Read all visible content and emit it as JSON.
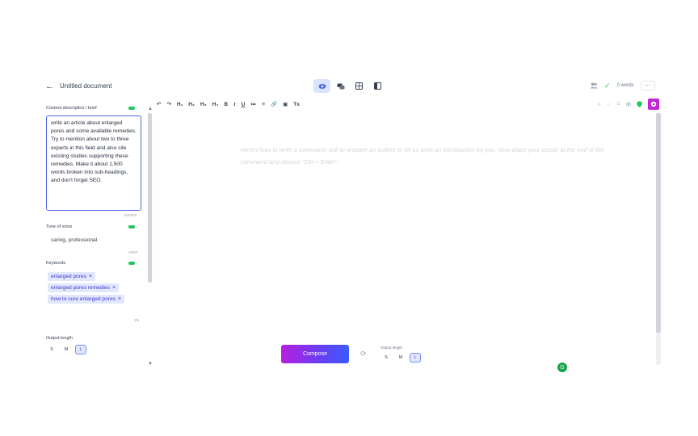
{
  "header": {
    "back_icon": "arrow-left-icon",
    "doc_title": "Untitled document",
    "view_modes": [
      "eye-icon",
      "chat-icon",
      "calculator-icon",
      "split-panel-icon"
    ],
    "words": "0 words",
    "more": "···"
  },
  "panel": {
    "brief_label": "Content description / brief",
    "brief_text": "write an article about enlarged pores and some available remedies. Try to mention about two to three experts in this field and also cite existing studies supporting these remedies. Make it about 1,500 words broken into sub-headings, and don't forget SEO.",
    "brief_count": "264/600",
    "tone_label": "Tone of voice",
    "tone_value": "caring, professional",
    "tone_count": "20/40",
    "keywords_label": "Keywords",
    "keywords": [
      "enlarged pores",
      "enlarged pores remedies",
      "how to cure enlarged pores"
    ],
    "keywords_count": "3/5",
    "output_label": "Output length",
    "sizes": [
      "S",
      "M",
      "L"
    ]
  },
  "toolbar": {
    "items": [
      "↶",
      "↷",
      "H₁",
      "H₂",
      "H₃",
      "H₄",
      "B",
      "I",
      "U",
      "≔",
      "≡",
      "🔗",
      "▣",
      "Tx"
    ]
  },
  "editor": {
    "placeholder": "Here's how to write a command: ask to prepare an outline or let us write an introduction for you. Now place your cursor at the end of the command and choose \"Ctrl + Enter\".",
    "compose_label": "Compose",
    "output_label": "Output length",
    "sizes": [
      "S",
      "M",
      "L"
    ]
  },
  "colors": {
    "accent": "#4f63e6",
    "compose_gradient_start": "#b620e0",
    "compose_gradient_end": "#3b5bfd",
    "toggle": "#22c55e"
  }
}
